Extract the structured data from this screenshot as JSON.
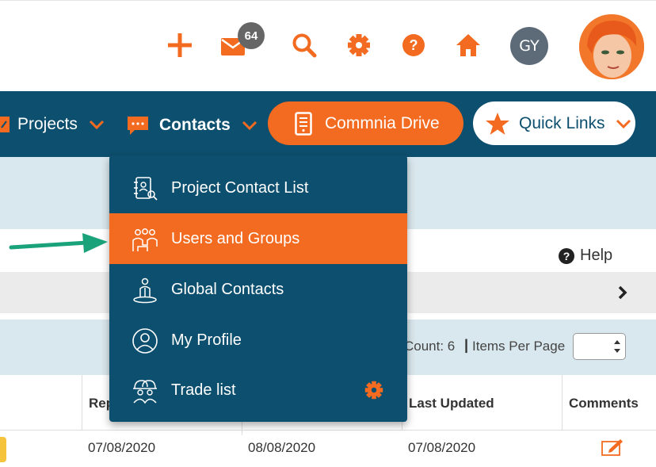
{
  "topbar": {
    "icons": [
      "plus-icon",
      "mail-icon",
      "search-icon",
      "gear-icon",
      "help-icon",
      "home-icon"
    ],
    "mail_badge": "64",
    "user_initials": "GY"
  },
  "nav": {
    "projects_label": "Projects",
    "contacts_label": "Contacts",
    "drive_label": "Commnia Drive",
    "quick_links_label": "Quick Links"
  },
  "contacts_menu": {
    "items": [
      {
        "label": "Project Contact List",
        "icon": "contact-list-icon"
      },
      {
        "label": "Users and Groups",
        "icon": "users-groups-icon",
        "active": true
      },
      {
        "label": "Global Contacts",
        "icon": "global-contacts-icon"
      },
      {
        "label": "My Profile",
        "icon": "profile-icon"
      },
      {
        "label": "Trade list",
        "icon": "trade-list-icon"
      }
    ]
  },
  "page": {
    "help_label": "Help",
    "count_label": "Count: 6",
    "items_per_page_label": "Items Per Page",
    "columns": [
      "Rep",
      "Last Updated",
      "Comments"
    ],
    "row": {
      "date1": "07/08/2020",
      "date2": "08/08/2020",
      "date3": "07/08/2020"
    }
  },
  "colors": {
    "accent": "#f26b21",
    "nav": "#0d4f6e",
    "band": "#d9e8ee",
    "arrow": "#1aa37a"
  }
}
